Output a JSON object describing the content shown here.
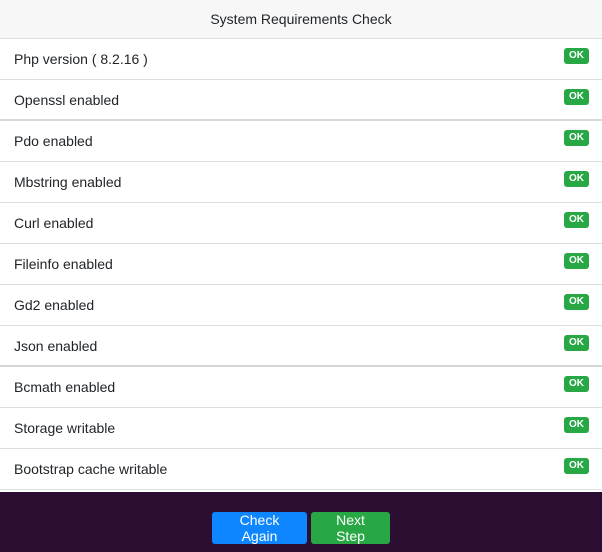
{
  "header": {
    "title": "System Requirements Check"
  },
  "requirements": [
    {
      "label": "Php version ( 8.2.16 )",
      "status": "OK"
    },
    {
      "label": "Openssl enabled",
      "status": "OK"
    },
    {
      "label": "Pdo enabled",
      "status": "OK"
    },
    {
      "label": "Mbstring enabled",
      "status": "OK"
    },
    {
      "label": "Curl enabled",
      "status": "OK"
    },
    {
      "label": "Fileinfo enabled",
      "status": "OK"
    },
    {
      "label": "Gd2 enabled",
      "status": "OK"
    },
    {
      "label": "Json enabled",
      "status": "OK"
    },
    {
      "label": "Bcmath enabled",
      "status": "OK"
    },
    {
      "label": "Storage writable",
      "status": "OK"
    },
    {
      "label": "Bootstrap cache writable",
      "status": "OK"
    }
  ],
  "footer": {
    "check_again_label": "Check Again",
    "next_step_label": "Next Step"
  },
  "colors": {
    "ok_badge": "#28a745",
    "primary_button": "#0d86ff",
    "footer_bg": "#2d0e33"
  }
}
